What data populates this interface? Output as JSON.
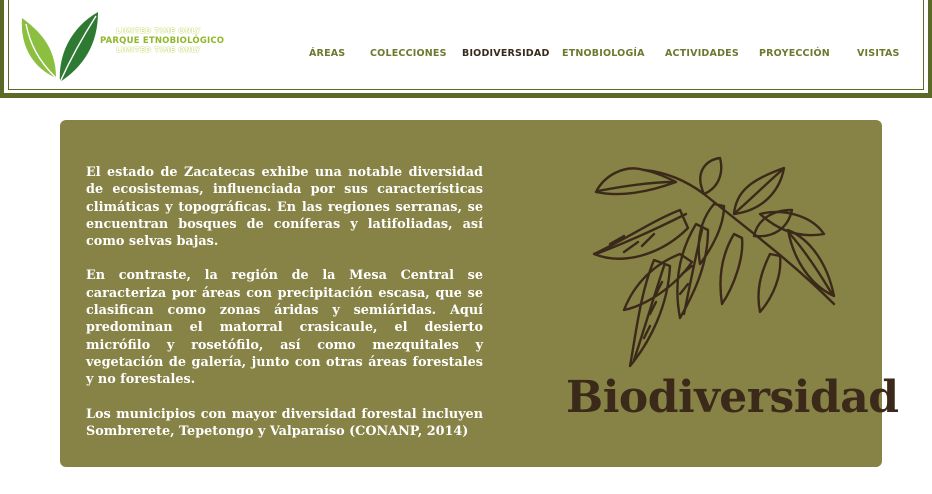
{
  "brand": {
    "ghost_text": "LIMITED TIME ONLY",
    "name": "PARQUE ETNOBIOLÓGICO"
  },
  "nav": {
    "items": [
      {
        "label": "ÁREAS"
      },
      {
        "label": "COLECCIONES"
      },
      {
        "label": "BIODIVERSIDAD",
        "active": true
      },
      {
        "label": "ETNOBIOLOGÍA"
      },
      {
        "label": "ACTIVIDADES"
      },
      {
        "label": "PROYECCIÓN"
      },
      {
        "label": "VISITAS"
      }
    ]
  },
  "main": {
    "paragraphs": [
      "El estado de Zacatecas exhibe una notable diversidad de ecosistemas, influenciada por sus características climáticas y topográficas. En las regiones serranas, se encuentran bosques de coníferas y latifoliadas, así como selvas bajas.",
      "En contraste, la región de la Mesa Central se caracteriza por áreas con precipitación escasa, que se clasifican como zonas áridas y semiáridas. Aquí predominan el matorral crasicaule, el desierto micrófilo y rosetófilo, así como mezquitales y vegetación de galería, junto con otras áreas forestales y no forestales.",
      "Los municipios con mayor diversidad forestal incluyen Sombrerete, Tepetongo y Valparaíso (CONANP, 2014)"
    ],
    "title": "Biodiversidad"
  },
  "colors": {
    "accent": "#5c6a27",
    "panel": "#878346",
    "nav_text": "#6b7a2e",
    "title": "#3b2a1a"
  },
  "icons": {
    "logo": "green-leaves-icon",
    "illustration": "leaf-branch-icon"
  }
}
